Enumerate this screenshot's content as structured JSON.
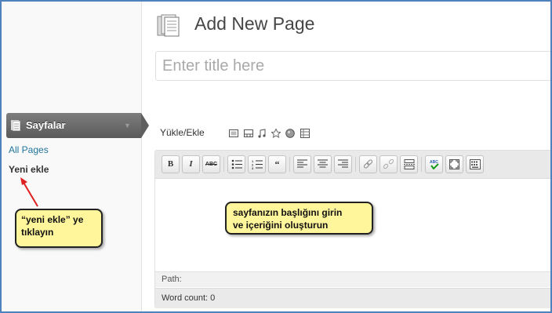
{
  "page": {
    "title": "Add New Page",
    "title_input_placeholder": "Enter title here"
  },
  "sidebar": {
    "menu_label": "Sayfalar",
    "items": [
      {
        "label": "All Pages"
      },
      {
        "label": "Yeni ekle"
      }
    ]
  },
  "media": {
    "label": "Yükle/Ekle",
    "icons": [
      "image-upload-icon",
      "video-upload-icon",
      "audio-upload-icon",
      "media-upload-icon",
      "circle-upload-icon",
      "gallery-icon"
    ]
  },
  "editor": {
    "toolbar": [
      {
        "name": "bold-button",
        "text": "B"
      },
      {
        "name": "italic-button",
        "text": "I"
      },
      {
        "name": "strikethrough-button",
        "text": "ABC"
      },
      {
        "name": "bullet-list-button"
      },
      {
        "name": "numbered-list-button"
      },
      {
        "name": "blockquote-button",
        "text": "66"
      },
      {
        "name": "align-left-button"
      },
      {
        "name": "align-center-button"
      },
      {
        "name": "align-right-button"
      },
      {
        "name": "link-button"
      },
      {
        "name": "unlink-button"
      },
      {
        "name": "more-tag-button"
      },
      {
        "name": "spellcheck-button"
      },
      {
        "name": "fullscreen-button"
      },
      {
        "name": "kitchen-sink-button"
      }
    ],
    "path_label": "Path:",
    "word_count_label": "Word count: 0"
  },
  "callouts": {
    "left_line1": "“yeni ekle” ye",
    "left_line2": "tıklayın",
    "main_line1": "sayfanızın başlığını girin",
    "main_line2": "ve içeriğini oluşturun"
  },
  "colors": {
    "accent": "#21759b",
    "frame": "#4f81bd",
    "callout_bg": "#fff59a",
    "menu_bg": "#5a5a5a",
    "arrow": "#e02020"
  }
}
